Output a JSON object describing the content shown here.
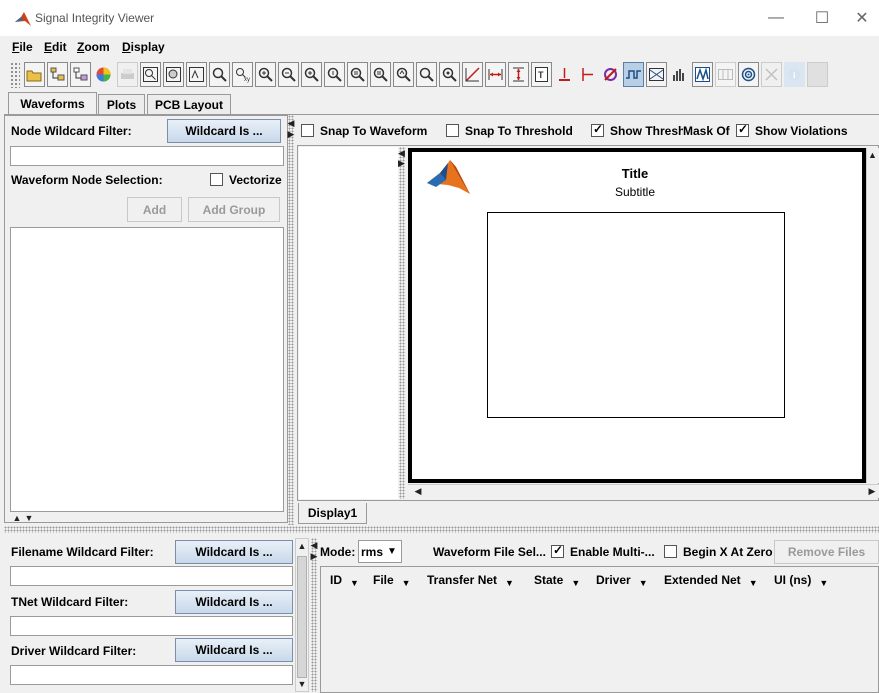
{
  "window": {
    "title": "Signal Integrity Viewer",
    "minimize": "—",
    "maximize": "☐",
    "close": "✕"
  },
  "menu": [
    "File",
    "Edit",
    "Zoom",
    "Display"
  ],
  "tabs": [
    "Waveforms",
    "Plots",
    "PCB Layout"
  ],
  "left_panel": {
    "node_filter_label": "Node Wildcard Filter:",
    "node_filter_button": "Wildcard Is ...",
    "node_filter_value": "",
    "node_selection_label": "Waveform Node Selection:",
    "vectorize_label": "Vectorize",
    "vectorize_checked": false,
    "add_button": "Add",
    "add_group_button": "Add Group"
  },
  "options": {
    "snap_waveform": "Snap To Waveform",
    "snap_waveform_checked": false,
    "snap_threshold": "Snap To Threshold",
    "snap_threshold_checked": false,
    "show_threshold": "Show Thresh",
    "show_threshold_checked": true,
    "mask_of": "Mask Of",
    "mask_of_checked": true,
    "show_violations": "Show Violations"
  },
  "plot": {
    "title": "Title",
    "subtitle": "Subtitle"
  },
  "display_tab": "Display1",
  "bottom_left": {
    "filename_filter_label": "Filename Wildcard Filter:",
    "tnet_filter_label": "TNet Wildcard Filter:",
    "driver_filter_label": "Driver Wildcard Filter:",
    "wildcard_button": "Wildcard Is ..."
  },
  "bottom_right": {
    "mode_label": "Mode:",
    "mode_value": "rms",
    "waveform_file_sel": "Waveform File Sel...",
    "enable_multi": "Enable Multi-...",
    "enable_multi_checked": true,
    "begin_x_at_zero": "Begin X At Zero",
    "begin_x_checked": false,
    "remove_files": "Remove Files",
    "columns": [
      "ID",
      "File",
      "Transfer Net",
      "State",
      "Driver",
      "Extended Net",
      "UI (ns)"
    ]
  },
  "colors": {
    "selected_button": "#b8cfe5",
    "matlab_logo_orange": "#e8731e",
    "matlab_logo_blue": "#2b6cb0"
  }
}
